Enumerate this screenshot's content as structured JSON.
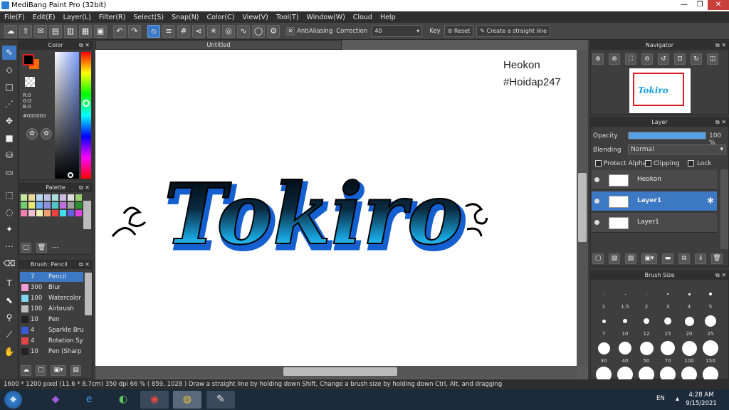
{
  "window": {
    "title": "MediBang Paint Pro (32bit)",
    "controls": [
      "—",
      "❐",
      "✕"
    ]
  },
  "menu": [
    "File(F)",
    "Edit(E)",
    "Layer(L)",
    "Filter(R)",
    "Select(S)",
    "Snap(N)",
    "Color(C)",
    "View(V)",
    "Tool(T)",
    "Window(W)",
    "Cloud",
    "Help"
  ],
  "toolbar": {
    "antialiasing": "AntiAliasing",
    "correction_label": "Correction",
    "correction_value": "40",
    "key_label": "Key",
    "reset_label": "Reset",
    "straight_line_label": "Create a straight line"
  },
  "color_panel": {
    "title": "Color",
    "r": "R:0",
    "g": "G:0",
    "b": "B:0",
    "hex": "#000000",
    "primary": "#000000",
    "secondary": "#ff6a00"
  },
  "palette_panel": {
    "title": "Palette",
    "footer_text": "---"
  },
  "brush_panel": {
    "title": "Brush: Pencil",
    "items": [
      {
        "size": "7",
        "name": "Pencil",
        "color": "#3c78c4",
        "selected": true
      },
      {
        "size": "300",
        "name": "Blur",
        "color": "#f19cd8"
      },
      {
        "size": "100",
        "name": "Watercolor",
        "color": "#7fd7f2"
      },
      {
        "size": "100",
        "name": "Airbrush",
        "color": "#bdbdbd"
      },
      {
        "size": "10",
        "name": "Pen",
        "color": "#222222"
      },
      {
        "size": "4",
        "name": "Sparkle Bru",
        "color": "#3a5ad8"
      },
      {
        "size": "4",
        "name": "Rotation Sy",
        "color": "#e04646"
      },
      {
        "size": "10",
        "name": "Pen (Sharp",
        "color": "#222222"
      }
    ]
  },
  "document": {
    "tab": "Untitled"
  },
  "canvas_text": {
    "line1": "Heokon",
    "line2": "#Hoidap247",
    "artwork": "Tokiro"
  },
  "navigator": {
    "title": "Navigator"
  },
  "layer_panel": {
    "title": "Layer",
    "opacity_label": "Opacity",
    "opacity_value": "100 %",
    "opacity_fraction": 1.0,
    "blending_label": "Blending",
    "blending_value": "Normal",
    "protect_alpha": "Protect Alpha",
    "clipping": "Clipping",
    "lock": "Lock",
    "layers": [
      {
        "name": "Heokon",
        "selected": false
      },
      {
        "name": "Layer1",
        "selected": true
      },
      {
        "name": "Layer1",
        "selected": false
      }
    ]
  },
  "brush_size": {
    "title": "Brush Size",
    "rows": [
      [
        "1",
        "1.5",
        "2",
        "3",
        "4",
        "5"
      ],
      [
        "7",
        "10",
        "12",
        "15",
        "20",
        "25"
      ],
      [
        "30",
        "40",
        "50",
        "70",
        "100",
        "150"
      ]
    ]
  },
  "status": {
    "text": "1600 * 1200 pixel  (11.6 * 8.7cm)  350 dpi  66 %  ( 859, 1028 )  Draw a straight line by holding down Shift, Change a brush size by holding down Ctrl, Alt, and dragging"
  },
  "taskbar": {
    "lang": "EN",
    "time": "4:28 AM",
    "date": "9/15/2021"
  }
}
